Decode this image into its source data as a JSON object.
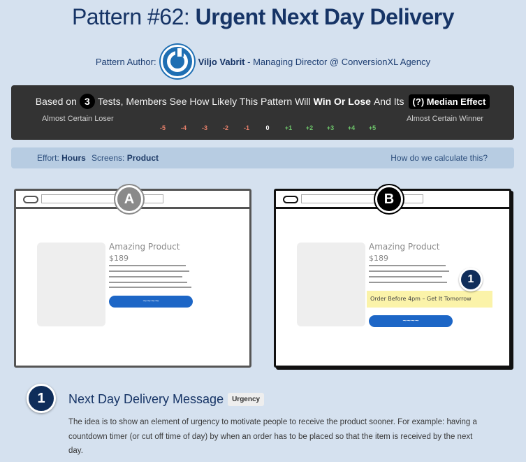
{
  "header": {
    "pattern_number": "Pattern #62:",
    "pattern_name": "Urgent Next Day Delivery"
  },
  "author": {
    "label": "Pattern Author:",
    "name": "Viljo Vabrit",
    "role": "- Managing Director @ ConversionXL Agency"
  },
  "score": {
    "prefix": "Based on",
    "tests_count": "3",
    "middle": "Tests, Members See How Likely This Pattern Will",
    "win_lose": "Win Or Lose",
    "and_its": "And Its",
    "median": "(?) Median Effect",
    "left_label": "Almost Certain Loser",
    "right_label": "Almost Certain Winner",
    "scale": [
      "-5",
      "-4",
      "-3",
      "-2",
      "-1",
      "0",
      "+1",
      "+2",
      "+3",
      "+4",
      "+5"
    ]
  },
  "meta": {
    "effort_label": "Effort:",
    "effort_value": "Hours",
    "screens_label": "Screens:",
    "screens_value": "Product",
    "calc_link": "How do we calculate this?"
  },
  "variant_a": {
    "badge": "A",
    "product_name": "Amazing Product",
    "price": "$189",
    "cta": "~~~~"
  },
  "variant_b": {
    "badge": "B",
    "product_name": "Amazing Product",
    "price": "$189",
    "urgency_text": "Order Before 4pm – Get It Tomorrow",
    "marker": "1",
    "cta": "~~~~"
  },
  "change": {
    "number": "1",
    "title": "Next Day Delivery Message",
    "tag": "Urgency",
    "description": "The idea is to show an element of urgency to motivate people to receive the product sooner. For example: having a countdown timer (or cut off time of day) by when an order has to be placed so that the item is received by the next day."
  }
}
